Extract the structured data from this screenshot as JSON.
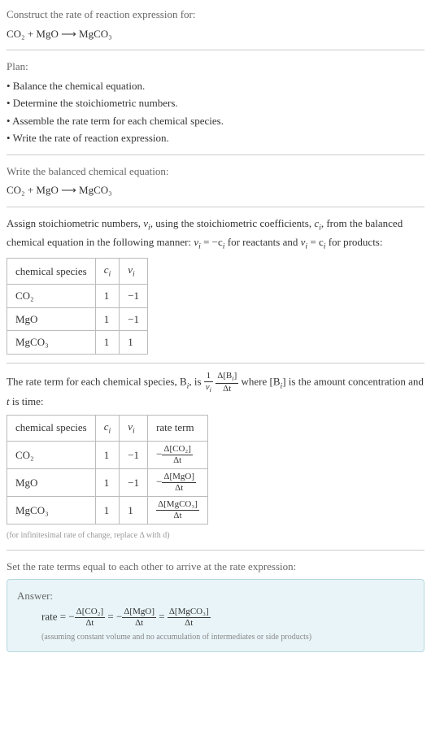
{
  "prompt": {
    "header": "Construct the rate of reaction expression for:",
    "equation": "CO₂ + MgO ⟶ MgCO₃"
  },
  "plan": {
    "header": "Plan:",
    "items": [
      "• Balance the chemical equation.",
      "• Determine the stoichiometric numbers.",
      "• Assemble the rate term for each chemical species.",
      "• Write the rate of reaction expression."
    ]
  },
  "balanced": {
    "header": "Write the balanced chemical equation:",
    "equation": "CO₂ + MgO ⟶ MgCO₃"
  },
  "stoich": {
    "intro_a": "Assign stoichiometric numbers, ",
    "intro_b": ", using the stoichiometric coefficients, ",
    "intro_c": ", from the balanced chemical equation in the following manner: ",
    "intro_d": " for reactants and ",
    "intro_e": " for products:",
    "nu": "ν",
    "c": "c",
    "eq1_lhs": "ν",
    "eq1_rhs": " = −c",
    "eq2_lhs": "ν",
    "eq2_rhs": " = c",
    "headers": {
      "col1": "chemical species",
      "col2": "cᵢ",
      "col3": "νᵢ"
    },
    "rows": [
      {
        "species": "CO₂",
        "c": "1",
        "nu": "−1"
      },
      {
        "species": "MgO",
        "c": "1",
        "nu": "−1"
      },
      {
        "species": "MgCO₃",
        "c": "1",
        "nu": "1"
      }
    ]
  },
  "rateterm": {
    "intro_a": "The rate term for each chemical species, B",
    "intro_b": ", is ",
    "intro_c": " where [B",
    "intro_d": "] is the amount concentration and ",
    "intro_e": " is time:",
    "t": "t",
    "frac1_num": "1",
    "frac1_den_prefix": "ν",
    "frac2_num_prefix": "Δ[B",
    "frac2_num_suffix": "]",
    "frac2_den": "Δt",
    "headers": {
      "col1": "chemical species",
      "col2": "cᵢ",
      "col3": "νᵢ",
      "col4": "rate term"
    },
    "rows": [
      {
        "species": "CO₂",
        "c": "1",
        "nu": "−1",
        "rate_sign": "−",
        "rate_num": "Δ[CO₂]",
        "rate_den": "Δt"
      },
      {
        "species": "MgO",
        "c": "1",
        "nu": "−1",
        "rate_sign": "−",
        "rate_num": "Δ[MgO]",
        "rate_den": "Δt"
      },
      {
        "species": "MgCO₃",
        "c": "1",
        "nu": "1",
        "rate_sign": "",
        "rate_num": "Δ[MgCO₃]",
        "rate_den": "Δt"
      }
    ],
    "caption": "(for infinitesimal rate of change, replace Δ with d)"
  },
  "final": {
    "header": "Set the rate terms equal to each other to arrive at the rate expression:"
  },
  "answer": {
    "label": "Answer:",
    "rate_prefix": "rate = ",
    "terms": [
      {
        "sign": "−",
        "num": "Δ[CO₂]",
        "den": "Δt"
      },
      {
        "sign": "−",
        "num": "Δ[MgO]",
        "den": "Δt"
      },
      {
        "sign": "",
        "num": "Δ[MgCO₃]",
        "den": "Δt"
      }
    ],
    "eq": " = ",
    "note": "(assuming constant volume and no accumulation of intermediates or side products)"
  },
  "sub_i": "i"
}
